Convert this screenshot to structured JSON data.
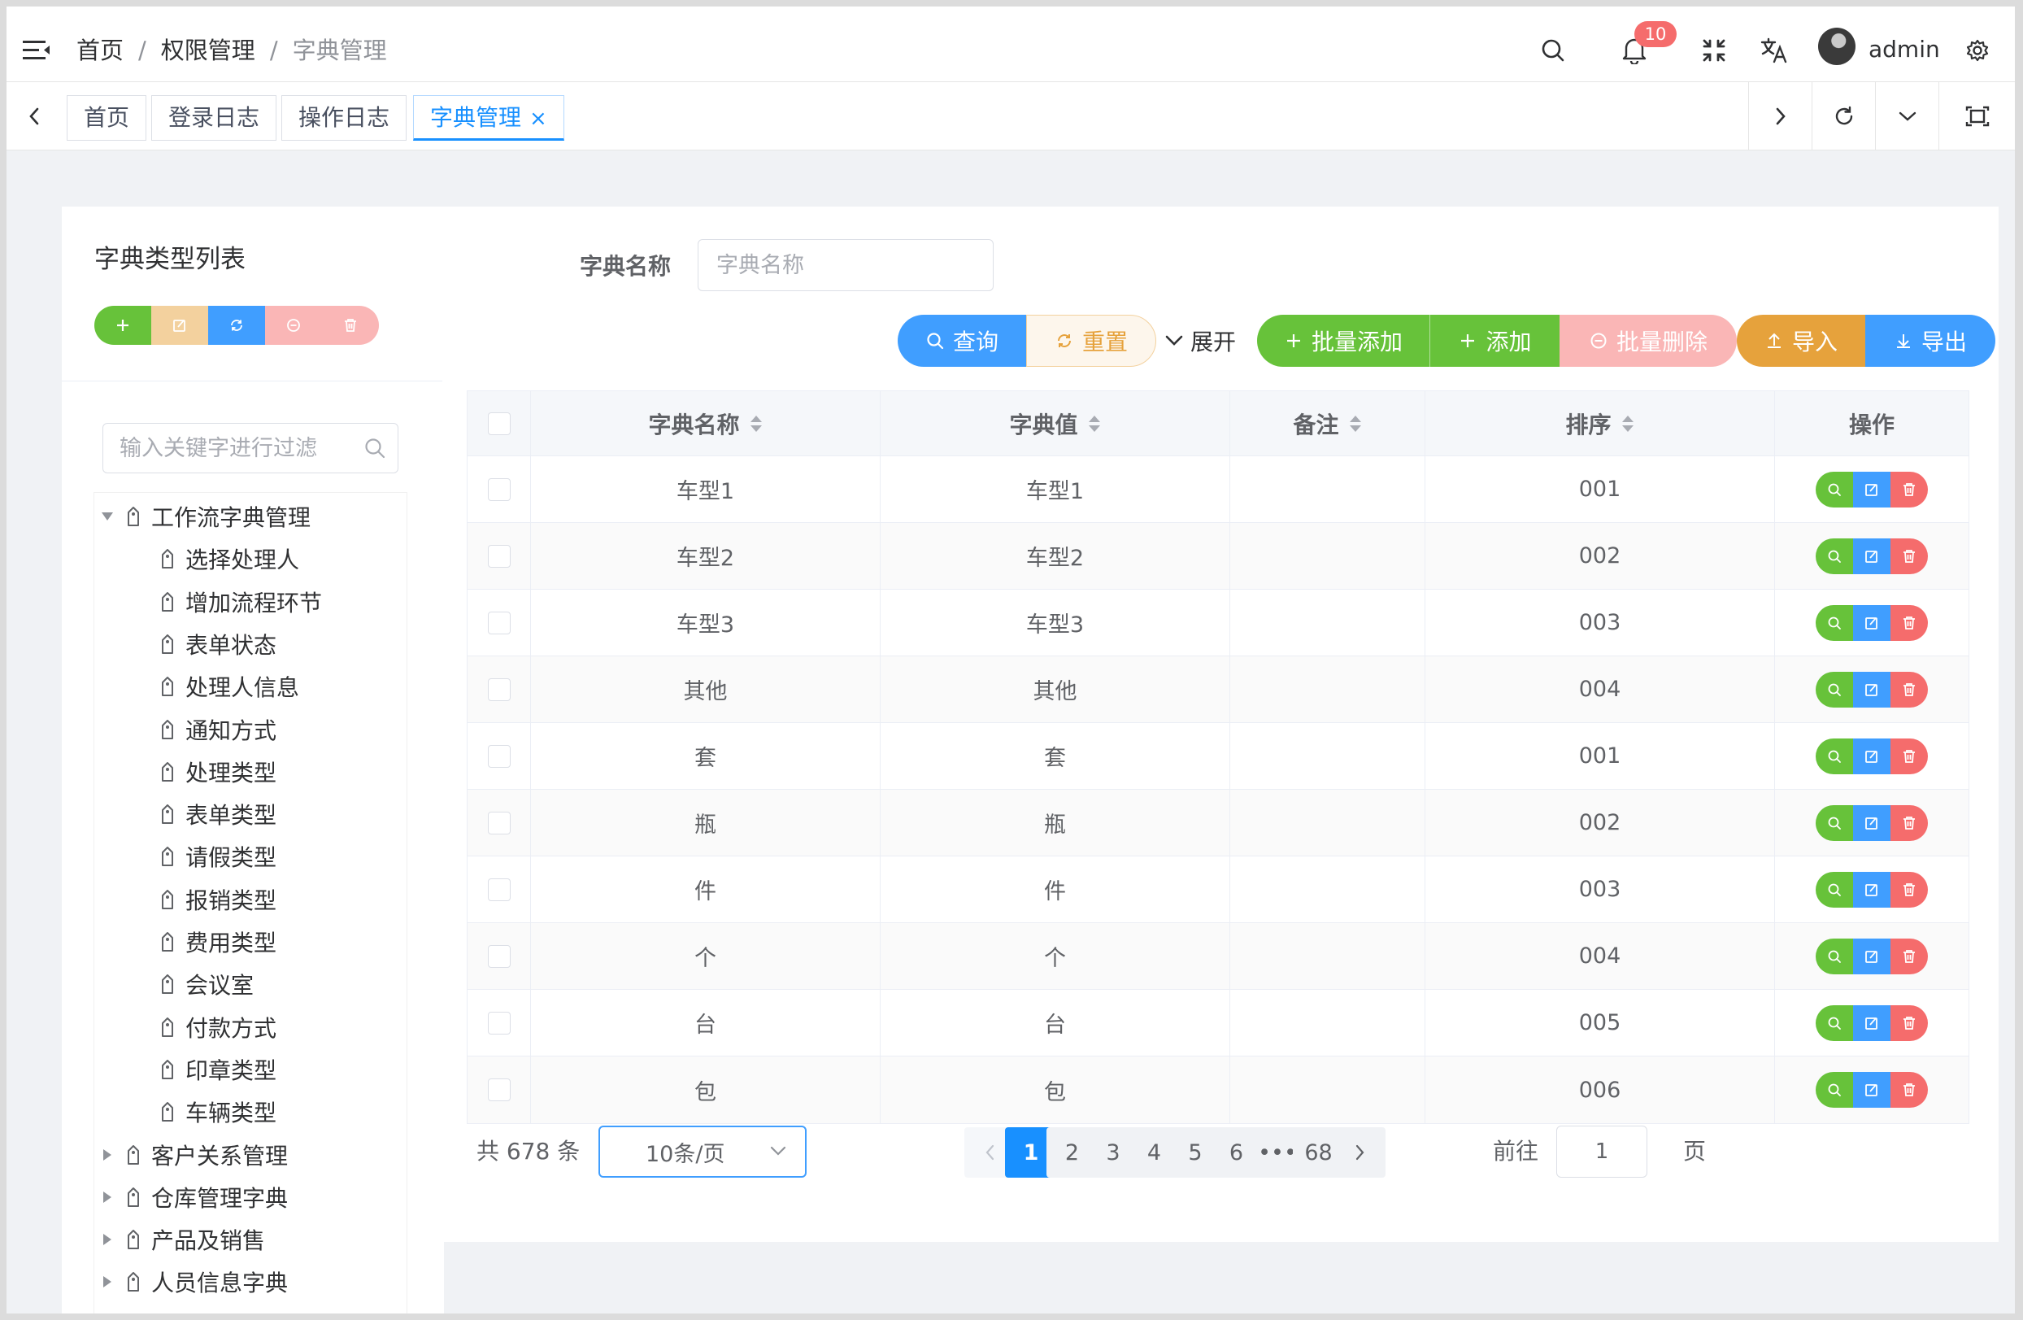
{
  "breadcrumb": [
    "首页",
    "权限管理",
    "字典管理"
  ],
  "header": {
    "notification_count": "10",
    "username": "admin"
  },
  "tabs": [
    {
      "label": "首页"
    },
    {
      "label": "登录日志"
    },
    {
      "label": "操作日志"
    },
    {
      "label": "字典管理",
      "active": true,
      "close": "×"
    }
  ],
  "left": {
    "title": "字典类型列表",
    "filter_placeholder": "输入关键字进行过滤",
    "tree": [
      {
        "label": "工作流字典管理",
        "expanded": true,
        "children": [
          "选择处理人",
          "增加流程环节",
          "表单状态",
          "处理人信息",
          "通知方式",
          "处理类型",
          "表单类型",
          "请假类型",
          "报销类型",
          "费用类型",
          "会议室",
          "付款方式",
          "印章类型",
          "车辆类型"
        ]
      },
      {
        "label": "客户关系管理",
        "expanded": false
      },
      {
        "label": "仓库管理字典",
        "expanded": false
      },
      {
        "label": "产品及销售",
        "expanded": false
      },
      {
        "label": "人员信息字典",
        "expanded": false
      }
    ]
  },
  "search": {
    "label": "字典名称",
    "placeholder": "字典名称"
  },
  "toolbar": {
    "query": "查询",
    "reset": "重置",
    "expand": "展开",
    "batch_add": "批量添加",
    "add": "添加",
    "batch_delete": "批量删除",
    "import": "导入",
    "export": "导出"
  },
  "table": {
    "columns": [
      "字典名称",
      "字典值",
      "备注",
      "排序",
      "操作"
    ],
    "rows": [
      {
        "name": "车型1",
        "value": "车型1",
        "remark": "",
        "order": "001"
      },
      {
        "name": "车型2",
        "value": "车型2",
        "remark": "",
        "order": "002"
      },
      {
        "name": "车型3",
        "value": "车型3",
        "remark": "",
        "order": "003"
      },
      {
        "name": "其他",
        "value": "其他",
        "remark": "",
        "order": "004"
      },
      {
        "name": "套",
        "value": "套",
        "remark": "",
        "order": "001"
      },
      {
        "name": "瓶",
        "value": "瓶",
        "remark": "",
        "order": "002"
      },
      {
        "name": "件",
        "value": "件",
        "remark": "",
        "order": "003"
      },
      {
        "name": "个",
        "value": "个",
        "remark": "",
        "order": "004"
      },
      {
        "name": "台",
        "value": "台",
        "remark": "",
        "order": "005"
      },
      {
        "name": "包",
        "value": "包",
        "remark": "",
        "order": "006"
      }
    ]
  },
  "pagination": {
    "total": "共 678 条",
    "page_size": "10条/页",
    "pages": [
      "1",
      "2",
      "3",
      "4",
      "5",
      "6",
      "•••",
      "68"
    ],
    "current": "1",
    "goto_label": "前往",
    "goto_value": "1",
    "goto_unit": "页"
  },
  "colors": {
    "primary": "#1890ff",
    "success": "#67c23a",
    "warning": "#e6a23c",
    "danger": "#f56c6c",
    "danger_light": "#fab6b6",
    "warning_light": "#f3d19e"
  }
}
